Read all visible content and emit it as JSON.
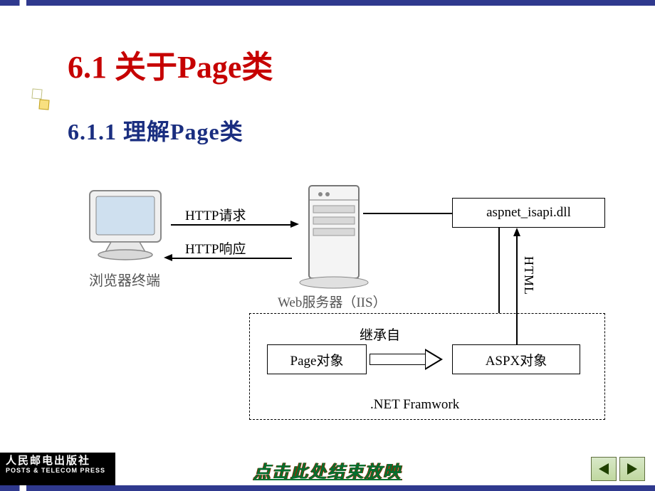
{
  "title": "6.1  关于Page类",
  "subtitle": "6.1.1  理解Page类",
  "diagram": {
    "client_label": "浏览器终端",
    "iis_label": "Web服务器（IIS）",
    "http_request": "HTTP请求",
    "http_response": "HTTP响应",
    "isapi": "aspnet_isapi.dll",
    "framework": ".NET Framwork",
    "page_obj": "Page对象",
    "aspx_obj": "ASPX对象",
    "inherit": "继承自",
    "html": "HTML"
  },
  "footer": {
    "publisher_cn": "人民邮电出版社",
    "publisher_en": "POSTS & TELECOM PRESS",
    "end_show": "点击此处结束放映"
  }
}
